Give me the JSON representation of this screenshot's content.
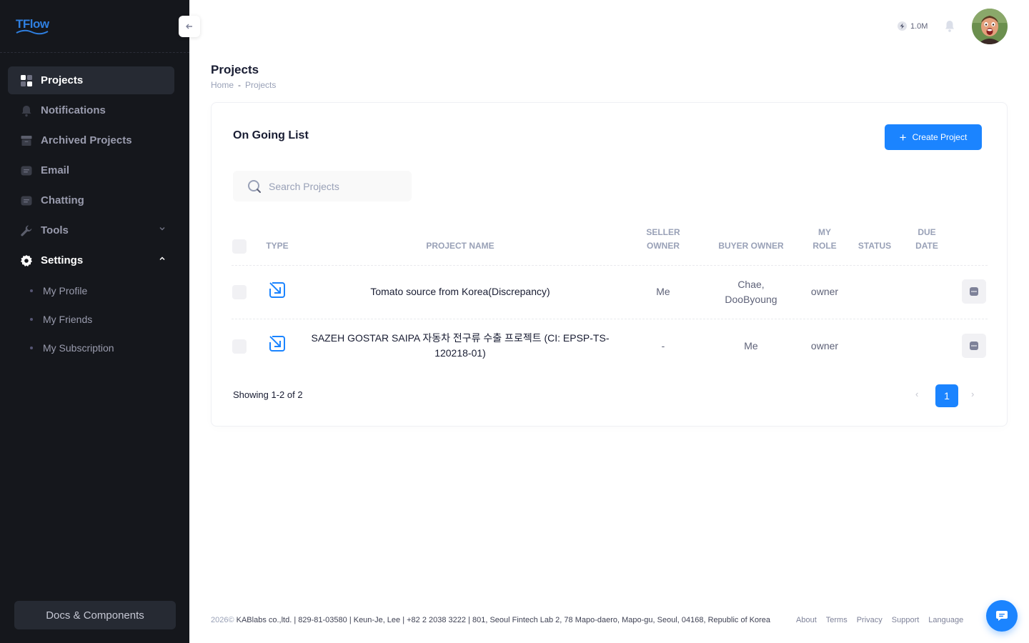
{
  "app": {
    "logo_text": "TFlow"
  },
  "sidebar": {
    "items": [
      {
        "label": "Projects",
        "icon": "grid-icon"
      },
      {
        "label": "Notifications",
        "icon": "bell-icon"
      },
      {
        "label": "Archived Projects",
        "icon": "archive-icon"
      },
      {
        "label": "Email",
        "icon": "message-icon"
      },
      {
        "label": "Chatting",
        "icon": "chat-icon"
      },
      {
        "label": "Tools",
        "icon": "wrench-icon"
      },
      {
        "label": "Settings",
        "icon": "gear-icon"
      }
    ],
    "settings_sub": [
      {
        "label": "My Profile"
      },
      {
        "label": "My Friends"
      },
      {
        "label": "My Subscription"
      }
    ],
    "docs_label": "Docs & Components"
  },
  "header": {
    "credits": "1.0M",
    "page_title": "Projects",
    "breadcrumb": {
      "home": "Home",
      "sep": "-",
      "current": "Projects"
    }
  },
  "card": {
    "title": "On Going List",
    "create_label": "Create Project",
    "search_placeholder": "Search Projects",
    "columns": {
      "type": "TYPE",
      "name": "PROJECT NAME",
      "seller_1": "SELLER",
      "seller_2": "OWNER",
      "buyer": "BUYER OWNER",
      "role_1": "MY",
      "role_2": "ROLE",
      "status": "STATUS",
      "due_1": "DUE",
      "due_2": "DATE"
    },
    "rows": [
      {
        "name_1": "Tomato source from Korea(Discrepancy)",
        "name_2": "",
        "seller": "Me",
        "buyer_1": "Chae,",
        "buyer_2": "DooByoung",
        "role": "owner",
        "status": "",
        "due": ""
      },
      {
        "name_1": "SAZEH GOSTAR SAIPA 자동차 전구류 수출 프로젝트 (CI: EPSP-TS-",
        "name_2": "120218-01)",
        "seller": "-",
        "buyer_1": "Me",
        "buyer_2": "",
        "role": "owner",
        "status": "",
        "due": ""
      }
    ],
    "showing": "Showing 1-2 of 2",
    "page": "1",
    "prev": "‹",
    "next": "›"
  },
  "footer": {
    "year": "2026©",
    "company": " KABlabs co.,ltd. | 829-81-03580 | Keun-Je, Lee | +82 2 2038 3222 | 801, Seoul Fintech Lab 2, 78 Mapo-daero, Mapo-gu, Seoul, 04168, Republic of Korea",
    "links": [
      "About",
      "Terms",
      "Privacy",
      "Support",
      "Language"
    ]
  },
  "colors": {
    "primary": "#1b84ff",
    "sidebar_bg": "#15171c",
    "sidebar_active": "#262a33"
  }
}
